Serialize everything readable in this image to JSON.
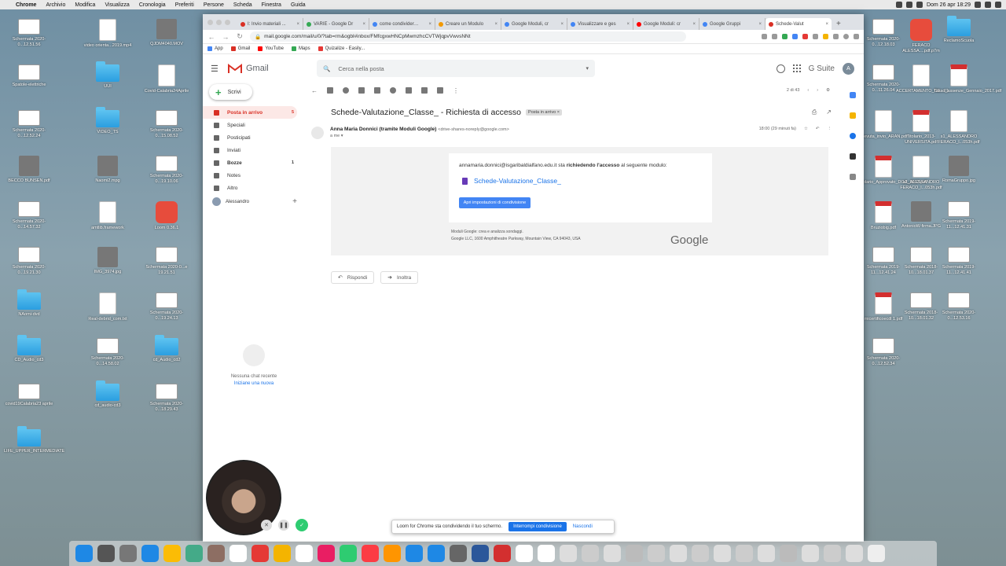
{
  "menubar": {
    "app": "Chrome",
    "items": [
      "Archivio",
      "Modifica",
      "Visualizza",
      "Cronologia",
      "Preferiti",
      "Persone",
      "Scheda",
      "Finestra",
      "Guida"
    ],
    "clock": "Dom 26 apr 18:29"
  },
  "desktop_left": [
    {
      "label": "Schermata 2020-0...12.51.56",
      "kind": "shot"
    },
    {
      "label": "video orienta...2019.mp4",
      "kind": "doc"
    },
    {
      "label": "QJDM4040.MOV",
      "kind": "img"
    },
    {
      "label": "Spatole-elettriche",
      "kind": "shot"
    },
    {
      "label": "UUI",
      "kind": "folder"
    },
    {
      "label": "Covid-Calabria24Aprile",
      "kind": "doc"
    },
    {
      "label": "Schermata 2020-0...12.52.24",
      "kind": "shot"
    },
    {
      "label": "VIDEO_TS",
      "kind": "folder"
    },
    {
      "label": "Schermata 2020-0...15.08.52",
      "kind": "shot"
    },
    {
      "label": "BECCO BUNSEN.pdf",
      "kind": "img"
    },
    {
      "label": "Naomi2.mpg",
      "kind": "img"
    },
    {
      "label": "Schermata 2020-0...19.10.06",
      "kind": "shot"
    },
    {
      "label": "Schermata 2020-0...14.57.32",
      "kind": "shot"
    },
    {
      "label": "amtlib.framework",
      "kind": "doc"
    },
    {
      "label": "Loom 0.36.1",
      "kind": "app"
    },
    {
      "label": "Schermata 2020-0...19.21.30",
      "kind": "shot"
    },
    {
      "label": "IMG_3974.jpg",
      "kind": "img"
    },
    {
      "label": "Schermata 2020-0...e 19.21.51",
      "kind": "shot"
    },
    {
      "label": "NAomi-dvd",
      "kind": "folder"
    },
    {
      "label": "Real-debrid_com.txt",
      "kind": "doc"
    },
    {
      "label": "Schermata 2020-0...19.24.13",
      "kind": "shot"
    },
    {
      "label": "CD_Audio_cd3",
      "kind": "folder"
    },
    {
      "label": "Schermata 2020-0...14.58.02",
      "kind": "shot"
    },
    {
      "label": "cd_Audio_cd2",
      "kind": "folder"
    },
    {
      "label": "covid19Calabria23 aprile",
      "kind": "shot"
    },
    {
      "label": "cd_audio-cd3",
      "kind": "folder"
    },
    {
      "label": "Schermata 2020-0...18.29.43",
      "kind": "shot"
    },
    {
      "label": "LIFE_UPPER_INTERMEDIATE",
      "kind": "folder"
    }
  ],
  "desktop_right": [
    {
      "label": "Schermata 2020-0...12.18.03",
      "kind": "shot"
    },
    {
      "label": "FERACO ALESSA....pdf.p7m",
      "kind": "app"
    },
    {
      "label": "ReclamoScuola",
      "kind": "folder"
    },
    {
      "label": "Schermata 2020-0...11.26.04",
      "kind": "shot"
    },
    {
      "label": "ACCERTAMENTO_CE...01",
      "kind": "doc"
    },
    {
      "label": "Tasso_assenze_Gennaio_2017.pdf",
      "kind": "pdf"
    },
    {
      "label": "ricevuta_invio_ARAN.pdf",
      "kind": "doc"
    },
    {
      "label": "Titolario_2013-UNIVERSITA.pdf",
      "kind": "pdf"
    },
    {
      "label": "s1_ALESSANDRO FERACO_l...053h.pdf",
      "kind": "doc"
    },
    {
      "label": "Titolario_Approvato_DGA_2013.pdf",
      "kind": "pdf"
    },
    {
      "label": "s2_ALESSANDRO FERACO_l...053h.pdf",
      "kind": "doc"
    },
    {
      "label": "RomaGruppo.jpg",
      "kind": "img"
    },
    {
      "label": "Bruziobig.pdf",
      "kind": "pdf"
    },
    {
      "label": "AntonioW-firma.JPG",
      "kind": "img"
    },
    {
      "label": "Schermata 2019-11...12.41.31",
      "kind": "shot"
    },
    {
      "label": "Schermata 2019-11...12.41.24",
      "kind": "shot"
    },
    {
      "label": "Schermata 2018-10...18.01.37",
      "kind": "shot"
    },
    {
      "label": "Schermata 2019-11...12.41.41",
      "kind": "shot"
    },
    {
      "label": "micertificoecdl 1.pdf",
      "kind": "pdf"
    },
    {
      "label": "Schermata 2018-10...18.01.32",
      "kind": "shot"
    },
    {
      "label": "Schermata 2020-0...12.53.16",
      "kind": "shot"
    },
    {
      "label": "Schermata 2020-0...12.52.34",
      "kind": "shot"
    }
  ],
  "browser": {
    "tabs": [
      {
        "title": "I: Invio materiali ...",
        "color": "#d93025"
      },
      {
        "title": "VARIE - Google Dr",
        "color": "#34a853"
      },
      {
        "title": "come condivider…",
        "color": "#4285f4"
      },
      {
        "title": "Creare un Modulo",
        "color": "#f29900"
      },
      {
        "title": "Google Moduli, cr",
        "color": "#4285f4"
      },
      {
        "title": "Visualizzare e ges",
        "color": "#4285f4"
      },
      {
        "title": "Google Moduli: cr",
        "color": "#ff0000"
      },
      {
        "title": "Google Gruppi",
        "color": "#4285f4"
      },
      {
        "title": "Schede-Valut",
        "color": "#d93025",
        "active": true
      }
    ],
    "url": "mail.google.com/mail/u/0/?tab=rm&ogbl#inbox/FMfcgxwHNCpMwmzhcCVTWjqpvVwvsNNt",
    "bookmarks": [
      {
        "label": "App",
        "color": "#4285f4"
      },
      {
        "label": "Gmail",
        "color": "#d93025"
      },
      {
        "label": "YouTube",
        "color": "#ff0000"
      },
      {
        "label": "Maps",
        "color": "#34a853"
      },
      {
        "label": "Quizalize - Easily...",
        "color": "#e53935"
      }
    ]
  },
  "gmail": {
    "product": "Gmail",
    "search_placeholder": "Cerca nella posta",
    "suite": "G Suite",
    "avatar_letter": "A",
    "compose": "Scrivi",
    "nav": [
      {
        "label": "Posta in arrivo",
        "count": "5",
        "selected": true
      },
      {
        "label": "Speciali",
        "count": ""
      },
      {
        "label": "Posticipati",
        "count": ""
      },
      {
        "label": "Inviati",
        "count": ""
      },
      {
        "label": "Bozze",
        "count": "1",
        "bold": true
      },
      {
        "label": "Notes",
        "count": ""
      },
      {
        "label": "Altro",
        "count": ""
      }
    ],
    "hangouts_user": "Alessandro",
    "no_chat": "Nessuna chat recente",
    "start_new": "Iniziane una nuova",
    "pager": "2 di 43",
    "subject": "Schede-Valutazione_Classe_ - Richiesta di accesso",
    "label": "Posta in arrivo ×",
    "sender_name": "Anna Maria Donnici (tramite Moduli Google)",
    "sender_email": "<drive-shares-noreply@google.com>",
    "to_me": "a me ▾",
    "time": "18:00 (29 minuti fa)",
    "body_email": "annamaria.donnici@isgaribaldialfano.edu.it",
    "body_text1": " sta ",
    "body_bold": "richiedendo l'accesso",
    "body_text2": " al seguente modulo:",
    "form_name": "Schede-Valutazione_Classe_",
    "button": "Apri impostazioni di condivisione",
    "footer1": "Moduli Google: crea e analizza sondaggi.",
    "footer2": "Google LLC, 1600 Amphitheatre Parkway, Mountain View, CA 94043, USA",
    "google_logo": "Google",
    "reply": "Rispondi",
    "forward": "Inoltra"
  },
  "loom": {
    "notice": "Loom for Chrome sta condividendo il tuo schermo.",
    "stop": "Interrompi condivisione",
    "hide": "Nascondi"
  },
  "dock_colors": [
    "#1e88e5",
    "#555",
    "#777",
    "#1e88e5",
    "#fbbc05",
    "#4a8",
    "#8d6e63",
    "#fff",
    "#e53935",
    "#f4b400",
    "#fff",
    "#e91e63",
    "#2ecc71",
    "#fc3c44",
    "#ff9500",
    "#1e88e5",
    "#1e88e5",
    "#666",
    "#2b579a",
    "#d32f2f",
    "#fff",
    "#fff",
    "#ddd",
    "#ccc",
    "#ddd",
    "#bbb",
    "#ccc",
    "#ddd",
    "#ccc",
    "#ddd",
    "#ccc",
    "#ddd",
    "#bbb",
    "#ddd",
    "#ccc",
    "#ddd",
    "#eee"
  ]
}
